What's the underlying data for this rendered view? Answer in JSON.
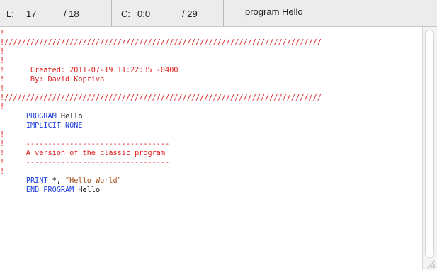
{
  "status_bar": {
    "line_label": "L:",
    "line_current": "17",
    "line_total": "/ 18",
    "col_label": "C:",
    "col_current": "0:0",
    "col_total": "/ 29",
    "function_name": "program Hello"
  },
  "editor": {
    "lines": [
      [
        {
          "t": "!",
          "c": "comment"
        }
      ],
      [
        {
          "t": "!/////////////////////////////////////////////////////////////////////////",
          "c": "comment"
        }
      ],
      [
        {
          "t": "!",
          "c": "comment"
        }
      ],
      [
        {
          "t": "!",
          "c": "comment"
        }
      ],
      [
        {
          "t": "!      Created: 2011-07-19 11:22:35 -0400",
          "c": "comment"
        }
      ],
      [
        {
          "t": "!      By: David Kopriva",
          "c": "comment"
        }
      ],
      [
        {
          "t": "!",
          "c": "comment"
        }
      ],
      [
        {
          "t": "!/////////////////////////////////////////////////////////////////////////",
          "c": "comment"
        }
      ],
      [
        {
          "t": "!",
          "c": "comment"
        }
      ],
      [
        {
          "t": "      ",
          "c": "plain"
        },
        {
          "t": "PROGRAM",
          "c": "kw"
        },
        {
          "t": " Hello",
          "c": "plain"
        }
      ],
      [
        {
          "t": "      ",
          "c": "plain"
        },
        {
          "t": "IMPLICIT NONE",
          "c": "kw"
        }
      ],
      [
        {
          "t": "!",
          "c": "comment"
        }
      ],
      [
        {
          "t": "!     ---------------------------------",
          "c": "comment"
        }
      ],
      [
        {
          "t": "!     A version of the classic program",
          "c": "comment"
        }
      ],
      [
        {
          "t": "!     ---------------------------------",
          "c": "comment"
        }
      ],
      [
        {
          "t": "!",
          "c": "comment"
        }
      ],
      [
        {
          "t": "      ",
          "c": "plain"
        },
        {
          "t": "PRINT",
          "c": "kw"
        },
        {
          "t": " *, ",
          "c": "plain"
        },
        {
          "t": "\"Hello World\"",
          "c": "str"
        }
      ],
      [
        {
          "t": "      ",
          "c": "plain"
        },
        {
          "t": "END PROGRAM",
          "c": "kw"
        },
        {
          "t": " Hello",
          "c": "plain"
        }
      ]
    ]
  }
}
